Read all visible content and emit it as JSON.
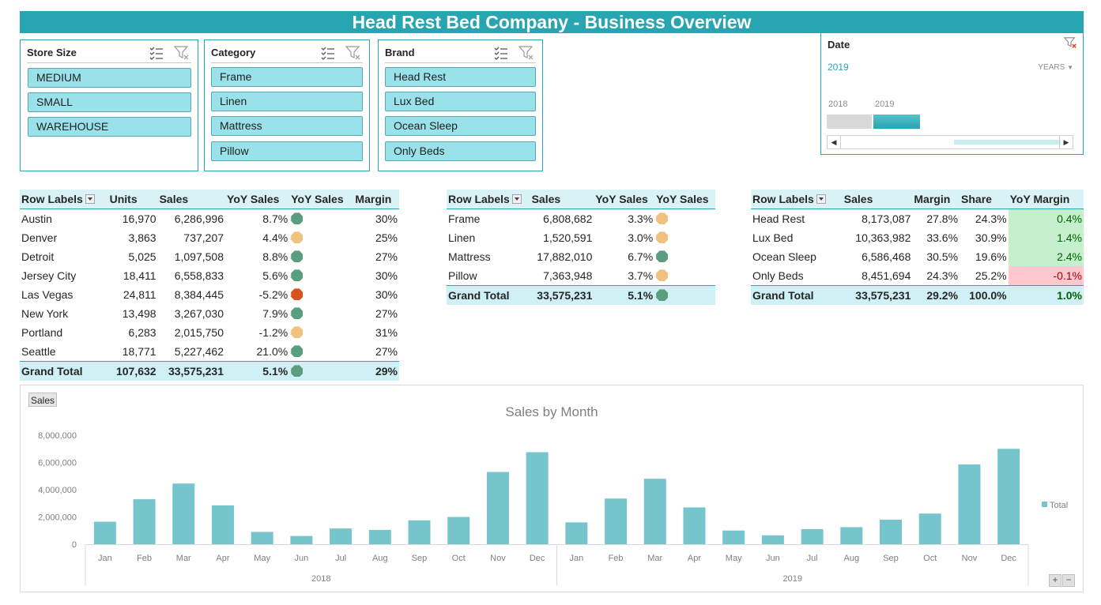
{
  "title": "Head Rest Bed Company - Business Overview",
  "colors": {
    "accent": "#27a5b1",
    "slicer_fill": "#9ae2ea",
    "bar": "#77c5cc",
    "icon_green": "#5a9e7f",
    "icon_yellow": "#f0c27e",
    "icon_red": "#d9531e"
  },
  "slicers": [
    {
      "title": "Store Size",
      "items": [
        "MEDIUM",
        "SMALL",
        "WAREHOUSE"
      ]
    },
    {
      "title": "Category",
      "items": [
        "Frame",
        "Linen",
        "Mattress",
        "Pillow"
      ]
    },
    {
      "title": "Brand",
      "items": [
        "Head Rest",
        "Lux Bed",
        "Ocean Sleep",
        "Only Beds"
      ]
    }
  ],
  "timeline": {
    "title": "Date",
    "selection": "2019",
    "level": "YEARS",
    "years": [
      "2018",
      "2019"
    ],
    "selected_year": "2019"
  },
  "pivot_city": {
    "headers": [
      "Row Labels",
      "Units",
      "Sales",
      "YoY Sales",
      "YoY Sales",
      "Margin"
    ],
    "rows": [
      {
        "label": "Austin",
        "units": "16,970",
        "sales": "6,286,996",
        "yoy": "8.7%",
        "icon": "green",
        "margin": "30%"
      },
      {
        "label": "Denver",
        "units": "3,863",
        "sales": "737,207",
        "yoy": "4.4%",
        "icon": "yellow",
        "margin": "25%"
      },
      {
        "label": "Detroit",
        "units": "5,025",
        "sales": "1,097,508",
        "yoy": "8.8%",
        "icon": "green",
        "margin": "27%"
      },
      {
        "label": "Jersey City",
        "units": "18,411",
        "sales": "6,558,833",
        "yoy": "5.6%",
        "icon": "green",
        "margin": "30%"
      },
      {
        "label": "Las Vegas",
        "units": "24,811",
        "sales": "8,384,445",
        "yoy": "-5.2%",
        "icon": "red",
        "margin": "30%"
      },
      {
        "label": "New York",
        "units": "13,498",
        "sales": "3,267,030",
        "yoy": "7.9%",
        "icon": "green",
        "margin": "27%"
      },
      {
        "label": "Portland",
        "units": "6,283",
        "sales": "2,015,750",
        "yoy": "-1.2%",
        "icon": "yellow",
        "margin": "31%"
      },
      {
        "label": "Seattle",
        "units": "18,771",
        "sales": "5,227,462",
        "yoy": "21.0%",
        "icon": "green",
        "margin": "27%"
      }
    ],
    "total": {
      "label": "Grand Total",
      "units": "107,632",
      "sales": "33,575,231",
      "yoy": "5.1%",
      "icon": "green",
      "margin": "29%"
    }
  },
  "pivot_category": {
    "headers": [
      "Row Labels",
      "Sales",
      "YoY Sales",
      "YoY Sales"
    ],
    "rows": [
      {
        "label": "Frame",
        "sales": "6,808,682",
        "yoy": "3.3%",
        "icon": "yellow"
      },
      {
        "label": "Linen",
        "sales": "1,520,591",
        "yoy": "3.0%",
        "icon": "yellow"
      },
      {
        "label": "Mattress",
        "sales": "17,882,010",
        "yoy": "6.7%",
        "icon": "green"
      },
      {
        "label": "Pillow",
        "sales": "7,363,948",
        "yoy": "3.7%",
        "icon": "yellow"
      }
    ],
    "total": {
      "label": "Grand Total",
      "sales": "33,575,231",
      "yoy": "5.1%",
      "icon": "green"
    }
  },
  "pivot_brand": {
    "headers": [
      "Row Labels",
      "Sales",
      "Margin",
      "Share",
      "YoY Margin"
    ],
    "rows": [
      {
        "label": "Head Rest",
        "sales": "8,173,087",
        "margin": "27.8%",
        "share": "24.3%",
        "yoy_margin": "0.4%",
        "positive": true
      },
      {
        "label": "Lux Bed",
        "sales": "10,363,982",
        "margin": "33.6%",
        "share": "30.9%",
        "yoy_margin": "1.4%",
        "positive": true
      },
      {
        "label": "Ocean Sleep",
        "sales": "6,586,468",
        "margin": "30.5%",
        "share": "19.6%",
        "yoy_margin": "2.4%",
        "positive": true
      },
      {
        "label": "Only Beds",
        "sales": "8,451,694",
        "margin": "24.3%",
        "share": "25.2%",
        "yoy_margin": "-0.1%",
        "positive": false
      }
    ],
    "total": {
      "label": "Grand Total",
      "sales": "33,575,231",
      "margin": "29.2%",
      "share": "100.0%",
      "yoy_margin": "1.0%"
    }
  },
  "chart_data": {
    "type": "bar",
    "title": "Sales by Month",
    "field_button": "Sales",
    "legend": {
      "position": "right",
      "entries": [
        "Total"
      ]
    },
    "groups": [
      "2018",
      "2019"
    ],
    "categories": [
      "Jan",
      "Feb",
      "Mar",
      "Apr",
      "May",
      "Jun",
      "Jul",
      "Aug",
      "Sep",
      "Oct",
      "Nov",
      "Dec",
      "Jan",
      "Feb",
      "Mar",
      "Apr",
      "May",
      "Jun",
      "Jul",
      "Aug",
      "Sep",
      "Oct",
      "Nov",
      "Dec"
    ],
    "series": [
      {
        "name": "Total",
        "values": [
          1650000,
          3300000,
          4450000,
          2850000,
          900000,
          600000,
          1150000,
          1050000,
          1750000,
          2000000,
          5300000,
          6750000,
          1600000,
          3350000,
          4800000,
          2700000,
          1000000,
          650000,
          1100000,
          1250000,
          1800000,
          2250000,
          5850000,
          7000000
        ]
      }
    ],
    "ylim": [
      0,
      8000000
    ],
    "yticks": [
      "8,000,000",
      "6,000,000",
      "4,000,000",
      "2,000,000",
      "0"
    ],
    "grid": false
  }
}
